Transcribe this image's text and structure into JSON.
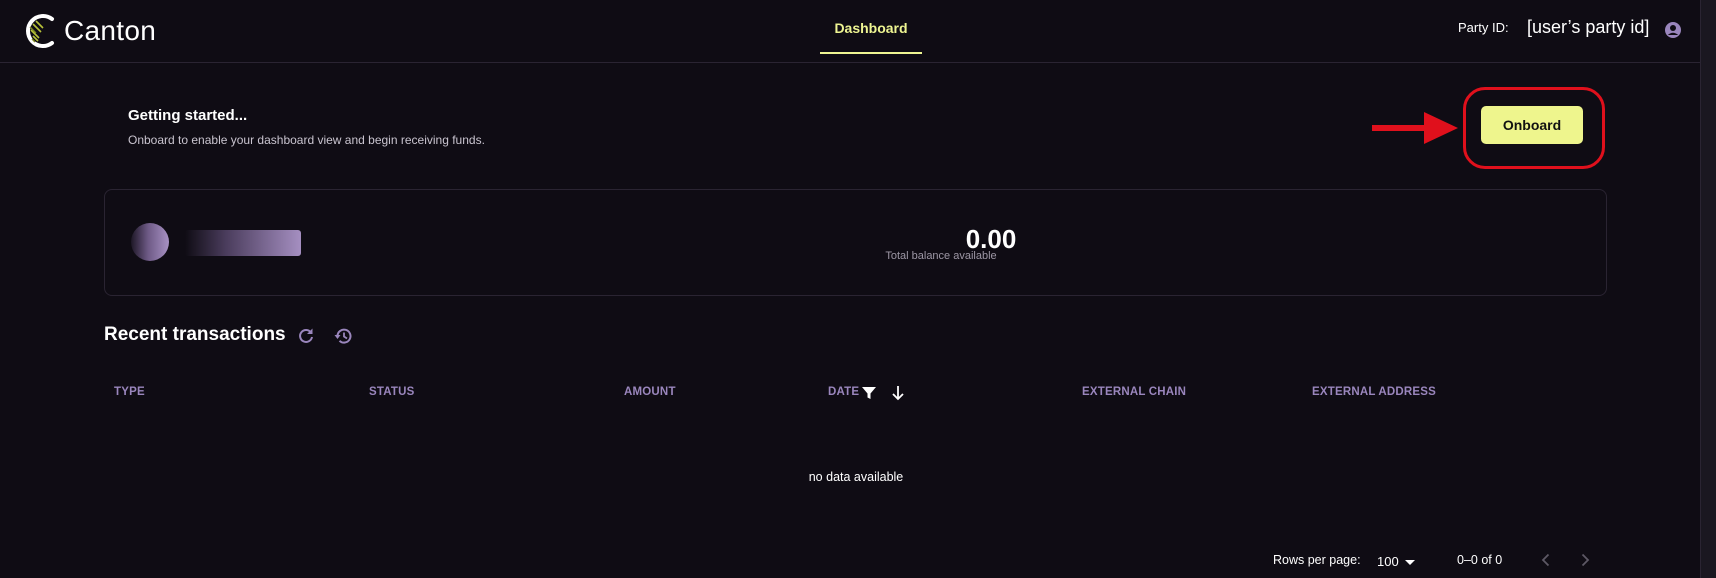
{
  "header": {
    "brand": "Canton",
    "nav_tab": "Dashboard",
    "party_label": "Party ID:",
    "party_id": "[user’s party id]",
    "account_icon": "account-circle-icon"
  },
  "getting_started": {
    "title": "Getting started...",
    "subtitle": "Onboard to enable your dashboard view and begin receiving funds.",
    "button_label": "Onboard",
    "annotation_color": "#e0101c"
  },
  "balance": {
    "amount": "0.00",
    "caption": "Total balance available"
  },
  "transactions": {
    "title": "Recent transactions",
    "refresh_icon": "refresh-icon",
    "history_icon": "history-icon",
    "columns": [
      "TYPE",
      "STATUS",
      "AMOUNT",
      "DATE",
      "EXTERNAL CHAIN",
      "EXTERNAL ADDRESS"
    ],
    "empty_text": "no data available"
  },
  "pagination": {
    "rows_label": "Rows per page:",
    "rows_value": "100",
    "range": "0–0 of 0"
  },
  "colors": {
    "accent": "#eef592",
    "background": "#0f0c14",
    "column_header": "#9a86bd"
  }
}
